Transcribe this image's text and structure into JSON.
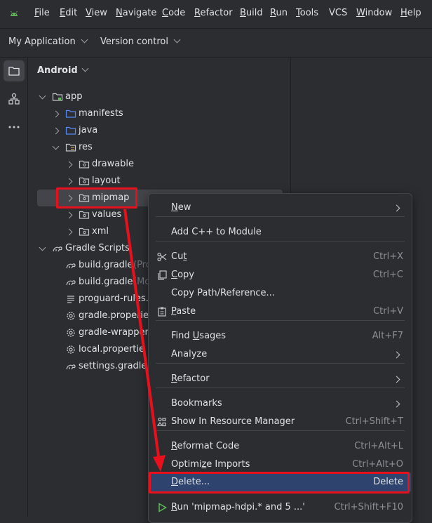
{
  "menubar": {
    "items": [
      {
        "label": "File",
        "u": "F",
        "rest": "ile"
      },
      {
        "label": "Edit",
        "u": "E",
        "rest": "dit"
      },
      {
        "label": "View",
        "u": "V",
        "rest": "iew"
      },
      {
        "label": "Navigate",
        "u": "N",
        "rest": "avigate"
      },
      {
        "label": "Code",
        "u": "C",
        "rest": "ode"
      },
      {
        "label": "Refactor",
        "u": "R",
        "rest": "efactor"
      },
      {
        "label": "Build",
        "u": "B",
        "rest": "uild"
      },
      {
        "label": "Run",
        "u": "R",
        "rest": "un"
      },
      {
        "label": "Tools",
        "u": "T",
        "rest": "ools"
      },
      {
        "label": "VCS",
        "u": "",
        "rest": "VCS"
      },
      {
        "label": "Window",
        "u": "W",
        "rest": "indow"
      },
      {
        "label": "Help",
        "u": "H",
        "rest": "elp"
      }
    ]
  },
  "projectbar": {
    "project": "My Application",
    "vcs": "Version control"
  },
  "panel": {
    "title": "Android",
    "tree": [
      {
        "label": "app",
        "icon": "module-folder-icon",
        "expanded": true
      },
      {
        "label": "manifests",
        "icon": "folder-icon",
        "expanded": false
      },
      {
        "label": "java",
        "icon": "folder-icon",
        "expanded": false
      },
      {
        "label": "res",
        "icon": "resource-folder-icon",
        "expanded": true
      },
      {
        "label": "drawable",
        "icon": "package-folder-icon",
        "expanded": false
      },
      {
        "label": "layout",
        "icon": "package-folder-icon",
        "expanded": false
      },
      {
        "label": "mipmap",
        "icon": "package-folder-icon",
        "expanded": false,
        "selected": true
      },
      {
        "label": "values",
        "icon": "package-folder-icon",
        "expanded": false
      },
      {
        "label": "xml",
        "icon": "package-folder-icon",
        "expanded": false
      },
      {
        "label": "Gradle Scripts",
        "icon": "gradle-icon",
        "expanded": true
      },
      {
        "label": "build.gradle",
        "suffix": "(Pro",
        "icon": "gradle-file-icon"
      },
      {
        "label": "build.gradle",
        "suffix": "(Mo",
        "icon": "gradle-file-icon"
      },
      {
        "label": "proguard-rules.",
        "icon": "text-file-icon"
      },
      {
        "label": "gradle.properie",
        "icon": "settings-file-icon"
      },
      {
        "label": "gradle-wrapper",
        "icon": "settings-file-icon"
      },
      {
        "label": "local.propertie",
        "icon": "settings-file-icon"
      },
      {
        "label": "settings.gradle",
        "icon": "gradle-file-icon"
      }
    ]
  },
  "context_menu": {
    "items": [
      {
        "label": "New",
        "u": "N",
        "rest": "ew",
        "submenu": true
      },
      {
        "label": "Add C++ to Module",
        "rest": "Add C++ to Module"
      },
      {
        "label": "Cut",
        "pre": "Cu",
        "u": "t",
        "rest": "",
        "shortcut": "Ctrl+X",
        "icon": "scissors-icon"
      },
      {
        "label": "Copy",
        "u": "C",
        "rest": "opy",
        "shortcut": "Ctrl+C",
        "icon": "copy-icon"
      },
      {
        "label": "Copy Path/Reference...",
        "rest": "Copy Path/Reference..."
      },
      {
        "label": "Paste",
        "u": "P",
        "rest": "aste",
        "shortcut": "Ctrl+V",
        "icon": "paste-icon"
      },
      {
        "label": "Find Usages",
        "pre": "Find ",
        "u": "U",
        "rest": "sages",
        "shortcut": "Alt+F7"
      },
      {
        "label": "Analyze",
        "rest": "Analyze",
        "submenu": true
      },
      {
        "label": "Refactor",
        "u": "R",
        "rest": "efactor",
        "submenu": true
      },
      {
        "label": "Bookmarks",
        "rest": "Bookmarks",
        "submenu": true
      },
      {
        "label": "Show In Resource Manager",
        "rest": "Show In Resource Manager",
        "shortcut": "Ctrl+Shift+T",
        "icon": "resource-manager-icon"
      },
      {
        "label": "Reformat Code",
        "u": "R",
        "rest": "eformat Code",
        "shortcut": "Ctrl+Alt+L"
      },
      {
        "label": "Optimize Imports",
        "pre": "Optimi",
        "u": "z",
        "rest": "e Imports",
        "shortcut": "Ctrl+Alt+O"
      },
      {
        "label": "Delete...",
        "u": "D",
        "rest": "elete...",
        "shortcut": "Delete",
        "highlighted": true
      },
      {
        "label": "Run 'mipmap-hdpi.* and 5 ...'",
        "u": "R",
        "rest": "un 'mipmap-hdpi.* and 5 ...'",
        "shortcut": "Ctrl+Shift+F10",
        "icon": "run-icon"
      }
    ]
  },
  "colors": {
    "background": "#2b2d30",
    "selection": "#43454a",
    "menu_highlight": "#2e436e",
    "annotation": "#e8101c",
    "folder_blue": "#548af7",
    "android_green": "#5fb85a",
    "run_green": "#5fb85a"
  }
}
